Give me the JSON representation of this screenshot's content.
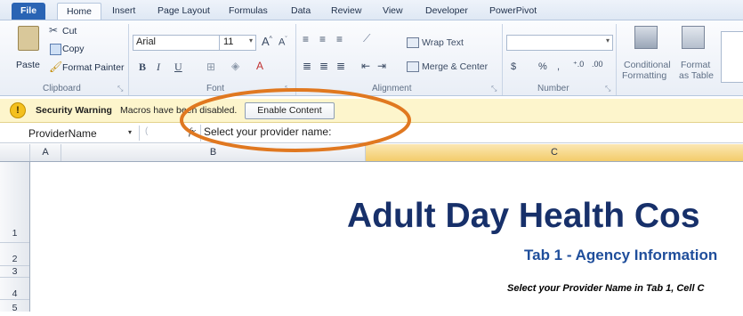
{
  "tabs": [
    "File",
    "Home",
    "Insert",
    "Page Layout",
    "Formulas",
    "Data",
    "Review",
    "View",
    "Developer",
    "PowerPivot"
  ],
  "clipboard": {
    "paste": "Paste",
    "cut": "Cut",
    "copy": "Copy",
    "format_painter": "Format Painter",
    "label": "Clipboard"
  },
  "font": {
    "name": "Arial",
    "size": "11",
    "label": "Font"
  },
  "alignment": {
    "wrap_text": "Wrap Text",
    "merge_center": "Merge & Center",
    "label": "Alignment"
  },
  "number": {
    "label": "Number",
    "currency": "$",
    "percent": "%",
    "comma": ","
  },
  "styles": {
    "conditional": "Conditional",
    "formatting": "Formatting",
    "format": "Format",
    "as_table": "as Table"
  },
  "security": {
    "title": "Security Warning",
    "message": "Macros have been disabled.",
    "button": "Enable Content"
  },
  "formula_bar": {
    "name_box": "ProviderName",
    "fx": "fx",
    "content": "Select your provider name:"
  },
  "columns": [
    "A",
    "B",
    "C"
  ],
  "rows": [
    "1",
    "2",
    "3",
    "4",
    "5"
  ],
  "sheet": {
    "title": "Adult Day Health Cos",
    "subtitle": "Tab 1 - Agency Information",
    "instruction": "Select your Provider Name in Tab 1, Cell C"
  },
  "colors": {
    "annotation": "#e07820",
    "title": "#17306a",
    "subtitle": "#1f4e9b"
  }
}
